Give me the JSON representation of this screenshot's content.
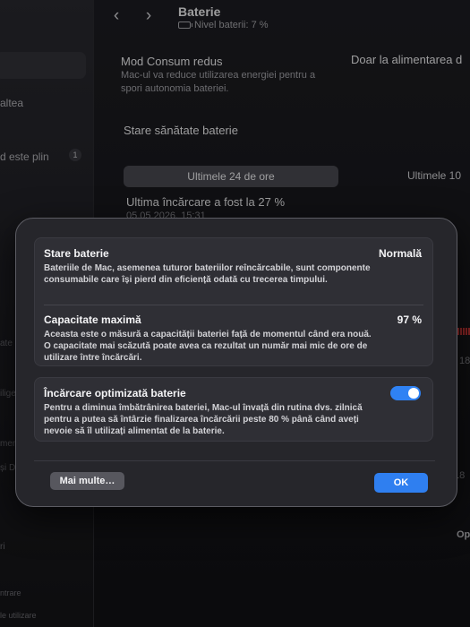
{
  "sidebar": {
    "items": [
      "altea",
      "d este plin",
      "ate",
      "iligen",
      "menio",
      "și Do",
      "ri",
      "ntrare",
      "le utilizare"
    ],
    "badge": "1"
  },
  "header": {
    "back_icon": "chevron-left-icon",
    "forward_icon": "chevron-right-icon",
    "title": "Baterie",
    "subtitle": "Nivel baterii: 7 %"
  },
  "background": {
    "low_power_title": "Mod Consum redus",
    "low_power_desc": "Mac-ul va reduce utilizarea energiei pentru a spori autonomia bateriei.",
    "low_power_value": "Doar la alimentarea d",
    "health_title": "Stare sănătate baterie",
    "seg_active": "Ultimele 24 de ore",
    "seg_other": "Ultimele 10",
    "last_charge": "Ultima încărcare a fost la 27 %",
    "last_charge_date": "05.05.2026, 15:31",
    "right_label_1": "18",
    "right_label_2": "18",
    "right_label_3": "Op"
  },
  "dialog": {
    "status_title": "Stare baterie",
    "status_value": "Normală",
    "status_desc": "Bateriile de Mac, asemenea tuturor bateriilor reîncărcabile, sunt componente consumabile care își pierd din eficiență odată cu trecerea timpului.",
    "capacity_title": "Capacitate maximă",
    "capacity_value": "97 %",
    "capacity_desc": "Aceasta este o măsură a capacității bateriei față de momentul când era nouă. O capacitate mai scăzută poate avea ca rezultat un număr mai mic de ore de utilizare între încărcări.",
    "optimized_title": "Încărcare optimizată baterie",
    "optimized_desc": "Pentru a diminua îmbătrânirea bateriei, Mac-ul învață din rutina dvs. zilnică pentru a putea să întârzie finalizarea încărcării peste 80 % până când aveți nevoie să îl utilizați alimentat de la baterie.",
    "optimized_on": true,
    "more_button": "Mai multe…",
    "ok_button": "OK"
  },
  "colors": {
    "accent": "#2f7ff0",
    "sheet": "#26262b",
    "background": "#1a1a1e"
  }
}
